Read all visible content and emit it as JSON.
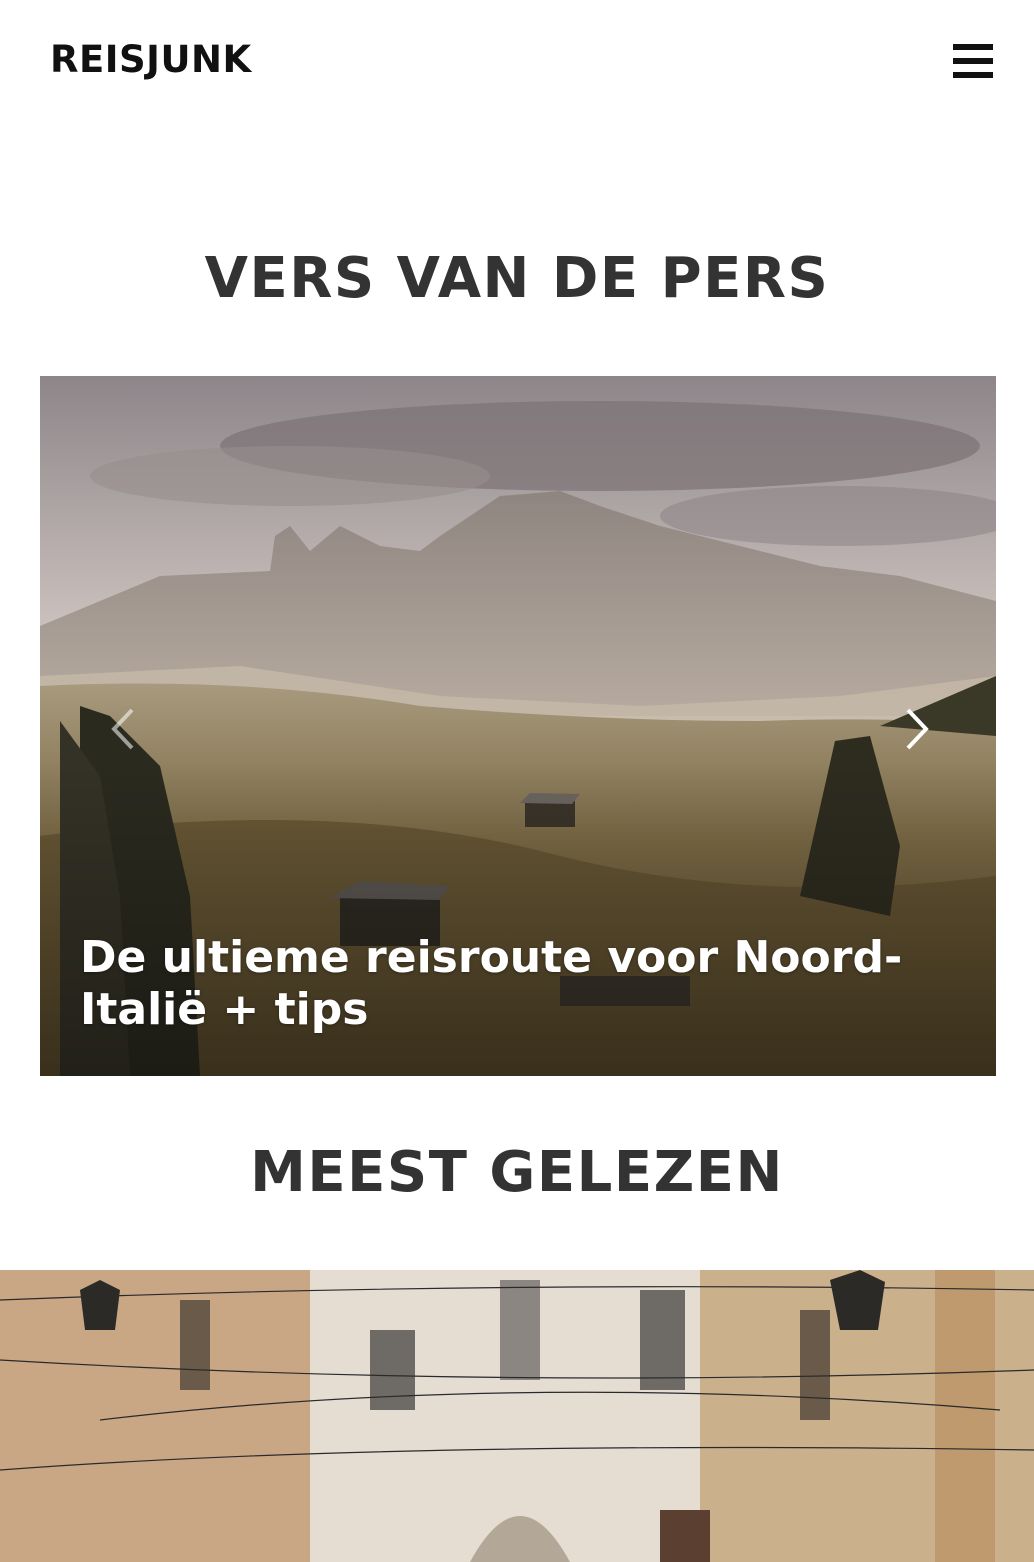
{
  "header": {
    "logo": "REISJUNK",
    "menu_icon": "hamburger-icon"
  },
  "sections": {
    "fresh_title": "VERS VAN DE PERS",
    "most_read_title": "MEEST GELEZEN"
  },
  "slider": {
    "caption": "De ultieme reisroute voor Noord-Italië + tips",
    "prev_icon": "chevron-left-icon",
    "next_icon": "chevron-right-icon"
  },
  "colors": {
    "text": "#333333",
    "logo": "#111111",
    "caption": "#ffffff"
  }
}
